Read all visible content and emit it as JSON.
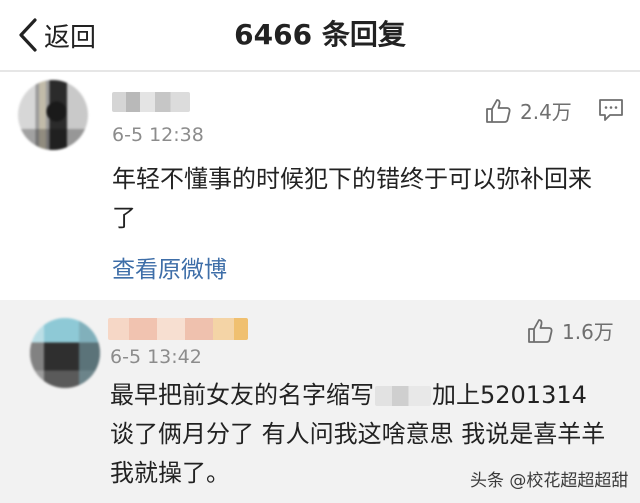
{
  "nav": {
    "back_label": "返回",
    "title": "6466 条回复"
  },
  "main_comment": {
    "username": "",
    "time": "6-5 12:38",
    "likes": "2.4万",
    "content": "年轻不懂事的时候犯下的错终于可以弥补回来了",
    "view_original": "查看原微博"
  },
  "reply": {
    "username": "",
    "time": "6-5 13:42",
    "likes": "1.6万",
    "content_before": "最早把前女友的名字缩写",
    "content_after": "加上5201314 谈了俩月分了 有人问我这啥意思 我说是喜羊羊 我就操了。"
  },
  "watermark": "头条 @校花超超超甜",
  "icons": [
    "back-chevron-icon",
    "thumb-up-icon",
    "reply-icon"
  ],
  "colors": {
    "link": "#3e6ea8",
    "meta": "#8c8c8c",
    "reply_bg": "#f2f2f2"
  }
}
